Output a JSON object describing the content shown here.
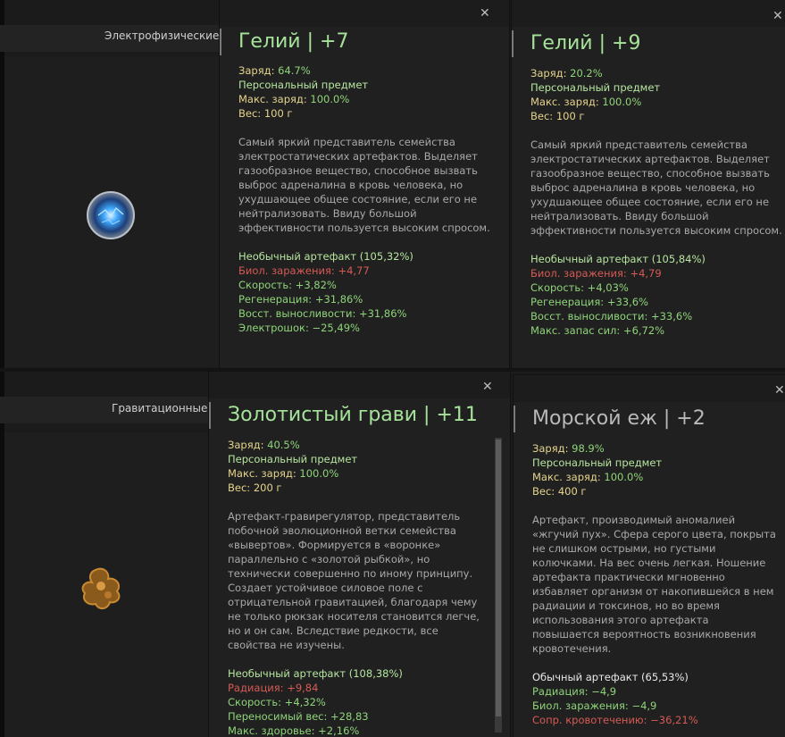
{
  "categories": {
    "electro": "Электрофизические",
    "gravity": "Гравитационные"
  },
  "cards": [
    {
      "id": "helium7",
      "title": "Гелий | +7",
      "title_color": "#a6e29a",
      "charge_label": "Заряд:",
      "charge_value": "64.7%",
      "personal": "Персональный предмет",
      "max_label": "Макс. заряд:",
      "max_value": "100.0%",
      "weight_label": "Вес:",
      "weight_value": "100 г",
      "description": "Самый яркий представитель семейства электростатических артефактов. Выделяет газообразное вещество, способное вызвать выброс адреналина в кровь человека, но ухудшающее общее состояние, если его не нейтрализовать. Ввиду большой эффективности пользуется высоким спросом.",
      "rarity": "Необычный артефакт (105,32%)",
      "stats": [
        {
          "text": "Биол. заражения: +4,77",
          "color": "red"
        },
        {
          "text": "Скорость: +3,82%",
          "color": "green"
        },
        {
          "text": "Регенерация: +31,86%",
          "color": "green"
        },
        {
          "text": "Восст. выносливости: +31,86%",
          "color": "green"
        },
        {
          "text": "Электрошок: −25,49%",
          "color": "green"
        }
      ]
    },
    {
      "id": "helium9",
      "title": "Гелий | +9",
      "title_color": "#a6e29a",
      "charge_label": "Заряд:",
      "charge_value": "20.2%",
      "personal": "Персональный предмет",
      "max_label": "Макс. заряд:",
      "max_value": "100.0%",
      "weight_label": "Вес:",
      "weight_value": "100 г",
      "description": "Самый яркий представитель семейства электростатических артефактов. Выделяет газообразное вещество, способное вызвать выброс адреналина в кровь человека, но ухудшающее общее состояние, если его не нейтрализовать. Ввиду большой эффективности пользуется высоким спросом.",
      "rarity": "Необычный артефакт (105,84%)",
      "stats": [
        {
          "text": "Биол. заражения: +4,79",
          "color": "red"
        },
        {
          "text": "Скорость: +4,03%",
          "color": "green"
        },
        {
          "text": "Регенерация: +33,6%",
          "color": "green"
        },
        {
          "text": "Восст. выносливости: +33,6%",
          "color": "green"
        },
        {
          "text": "Макс. запас сил: +6,72%",
          "color": "green"
        }
      ]
    },
    {
      "id": "gravi",
      "title": "Золотистый грави | +11",
      "title_color": "#a6e29a",
      "charge_label": "Заряд:",
      "charge_value": "40.5%",
      "personal": "Персональный предмет",
      "max_label": "Макс. заряд:",
      "max_value": "100.0%",
      "weight_label": "Вес:",
      "weight_value": "200 г",
      "description": "Артефакт-гравирегулятор, представитель побочной эволюционной ветки семейства «вывертов». Формируется в «воронке» параллельно с «золотой рыбкой», но технически совершенно по иному принципу. Создает устойчивое силовое поле с отрицательной гравитацией, благодаря чему не только рюкзак носителя становится легче, но и он сам. Вследствие редкости, все свойства не изучены.",
      "rarity": "Необычный артефакт (108,38%)",
      "stats": [
        {
          "text": "Радиация: +9,84",
          "color": "red"
        },
        {
          "text": "Скорость: +4,32%",
          "color": "green"
        },
        {
          "text": "Переносимый вес: +28,83",
          "color": "green"
        },
        {
          "text": "Макс. здоровье: +2,16%",
          "color": "green"
        }
      ]
    },
    {
      "id": "urchin",
      "title": "Морской еж | +2",
      "title_color": "#b9b9b9",
      "charge_label": "Заряд:",
      "charge_value": "98.9%",
      "personal": "Персональный предмет",
      "max_label": "Макс. заряд:",
      "max_value": "100.0%",
      "weight_label": "Вес:",
      "weight_value": "400 г",
      "description": "Артефакт, производимый аномалией «жгучий пух». Сфера серого цвета, покрыта не слишком острыми, но густыми колючками. На вес очень легкая. Ношение артефакта практически мгновенно избавляет организм от накопившейся в нем радиации и токсинов, но во время использования этого артефакта повышается вероятность возникновения кровотечения.",
      "rarity": "Обычный артефакт (65,53%)",
      "stats": [
        {
          "text": "Радиация: −4,9",
          "color": "green"
        },
        {
          "text": "Биол. заражения: −4,9",
          "color": "green"
        },
        {
          "text": "Сопр. кровотечению: −36,21%",
          "color": "red"
        }
      ]
    }
  ],
  "icons": {
    "close": "✕"
  }
}
